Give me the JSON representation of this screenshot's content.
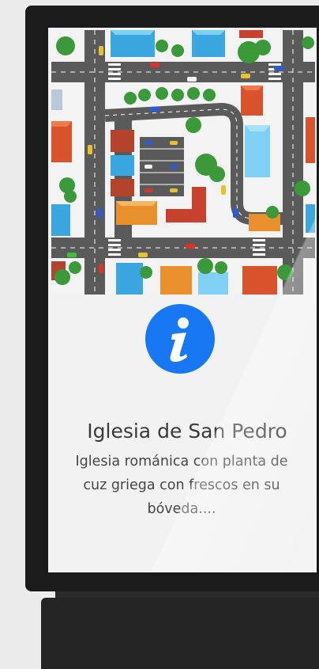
{
  "poi": {
    "title": "Iglesia de San Pedro",
    "description": "Iglesia románica con planta de cuz griega con frescos en su bóveda....",
    "icon": "info-icon"
  },
  "map": {
    "icon": "city-map-illustration"
  },
  "colors": {
    "accent": "#1877f2",
    "frame": "#1b1b1b",
    "screen": "#f2f2f2",
    "road": "#5a5a5a",
    "grass": "#f4f4f4"
  }
}
